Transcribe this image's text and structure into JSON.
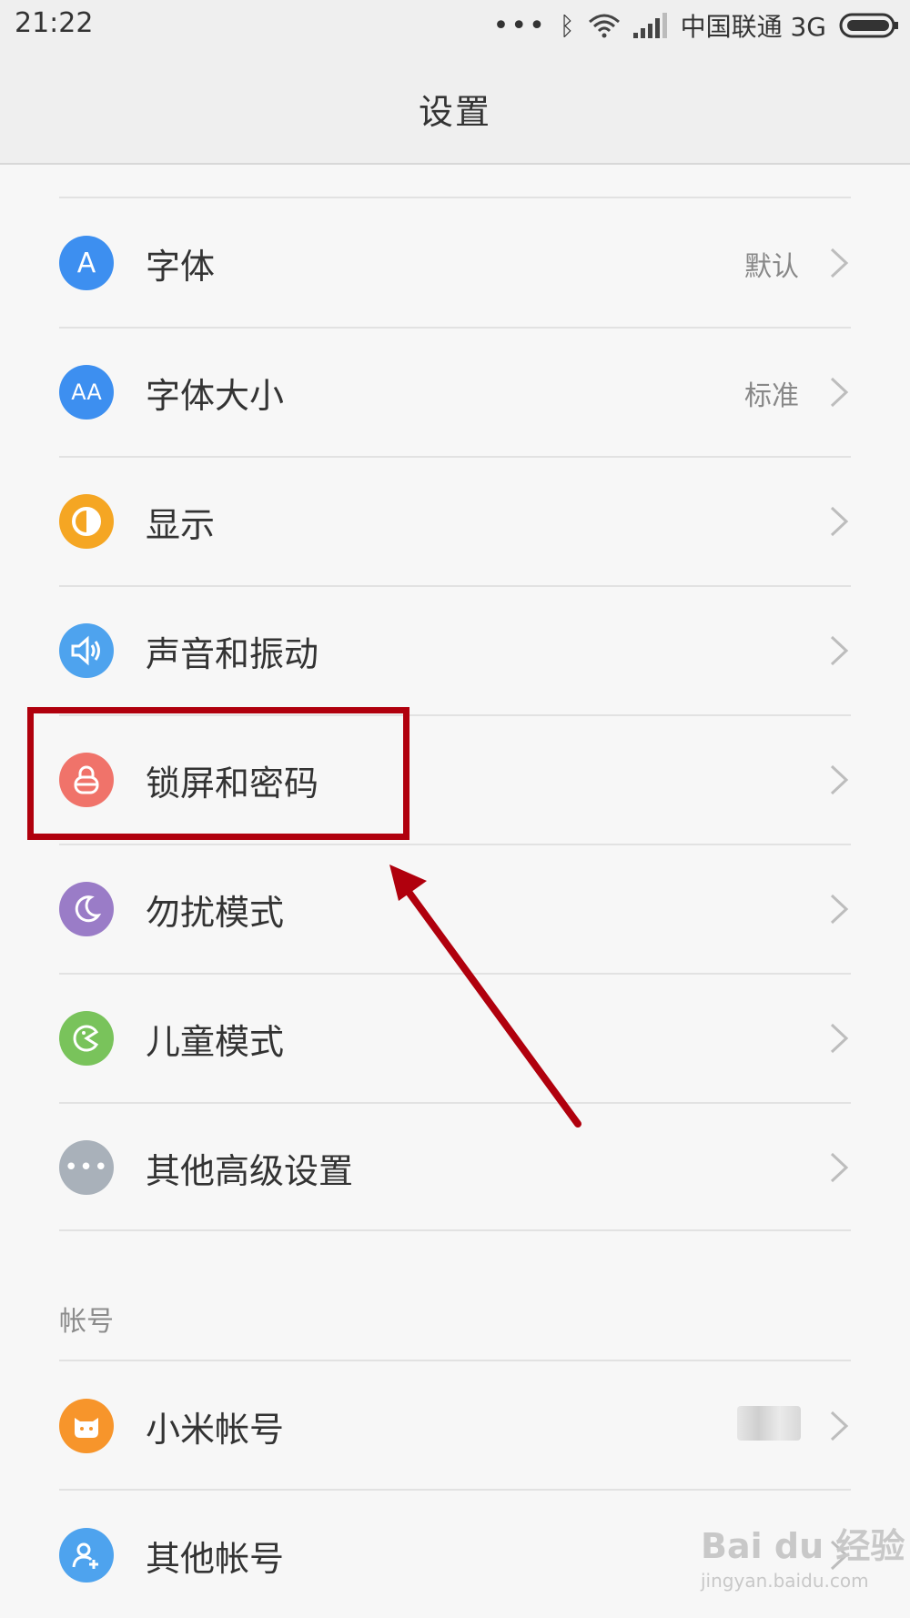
{
  "status_bar": {
    "time": "21:22",
    "carrier": "中国联通 3G"
  },
  "header": {
    "title": "设置"
  },
  "settings": [
    {
      "label": "字体",
      "value": "默认",
      "icon": "font-icon",
      "color": "#3d8ff0"
    },
    {
      "label": "字体大小",
      "value": "标准",
      "icon": "font-size-icon",
      "color": "#3d8ff0"
    },
    {
      "label": "显示",
      "value": "",
      "icon": "display-icon",
      "color": "#f5a623"
    },
    {
      "label": "声音和振动",
      "value": "",
      "icon": "speaker-icon",
      "color": "#4ea3ee"
    },
    {
      "label": "锁屏和密码",
      "value": "",
      "icon": "lock-icon",
      "color": "#f0736a"
    },
    {
      "label": "勿扰模式",
      "value": "",
      "icon": "moon-icon",
      "color": "#9a7cc7"
    },
    {
      "label": "儿童模式",
      "value": "",
      "icon": "child-mode-icon",
      "color": "#79c35b"
    },
    {
      "label": "其他高级设置",
      "value": "",
      "icon": "more-icon",
      "color": "#a9b1ba"
    }
  ],
  "account_section": {
    "title": "帐号"
  },
  "accounts": [
    {
      "label": "小米帐号",
      "icon": "mi-icon",
      "color": "#f7952b"
    },
    {
      "label": "其他帐号",
      "icon": "add-user-icon",
      "color": "#4ea3ee"
    }
  ],
  "watermark": {
    "brand": "Bai du 经验",
    "url": "jingyan.baidu.com"
  },
  "annotation": {
    "color": "#b0000d"
  }
}
